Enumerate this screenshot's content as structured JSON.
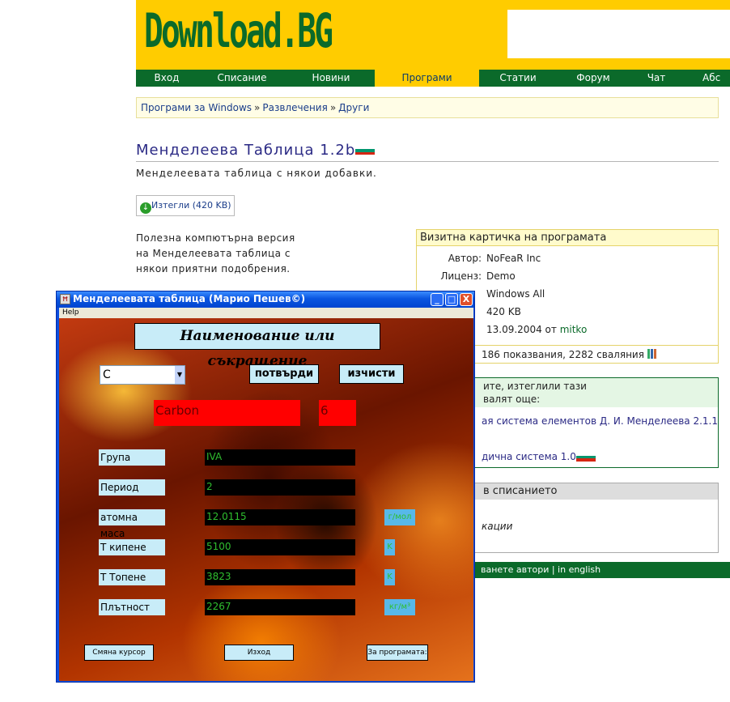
{
  "site": {
    "logo": "Download.BG",
    "nav": [
      "Вход",
      "Списание",
      "Новини",
      "Програми",
      "Статии",
      "Форум",
      "Чат",
      "Абс"
    ],
    "nav_active": "Програми"
  },
  "breadcrumb": [
    "Програми за Windows",
    "Развлечения",
    "Други"
  ],
  "breadcrumb_sep": "»",
  "program": {
    "title": "Менделеева Таблица 1.2b",
    "subtitle": "Менделеевата таблица с някои добавки.",
    "download_label": "Изтегли (420 KB)",
    "description": "Полезна компютърна версия на Менделеевата таблица с някои приятни подобрения."
  },
  "card": {
    "heading": "Визитна картичка на програмата",
    "rows": [
      {
        "label": "Автор:",
        "value": "NoFeaR Inc"
      },
      {
        "label": "Лиценз:",
        "value": "Demo"
      },
      {
        "label": "",
        "value": "Windows All"
      },
      {
        "label": "",
        "value": "420 KB"
      },
      {
        "label": "",
        "value": "13.09.2004 от"
      }
    ],
    "uploader": "mitko",
    "stats": "186 показвания, 2282 сваляния"
  },
  "also": {
    "heading_line1": "ите, изтеглили тази",
    "heading_line2": "валят още:",
    "links": [
      "ая система елементов Д. И. Менделеева 2.1.1",
      "дична система 1.0"
    ]
  },
  "magazine": {
    "heading": "в списанието",
    "link": "кации"
  },
  "footer": "ванете автори | in english",
  "flag_colors": [
    "#ffffff",
    "#00966e",
    "#d62612"
  ],
  "app": {
    "title": "Менделеевата таблица (Марио Пешев©)",
    "menu": "Help",
    "heading": "Наименование или съкращение",
    "combo_value": "C",
    "confirm": "потвърди",
    "clear": "изчисти",
    "element_name": "Carbon",
    "element_number": "6",
    "fields": [
      {
        "label": "Група",
        "value": "IVA",
        "unit": ""
      },
      {
        "label": "Период",
        "value": "2",
        "unit": ""
      },
      {
        "label": "атомна маса",
        "value": "12.0115",
        "unit": "г/мол"
      },
      {
        "label": "Т кипене",
        "value": "5100",
        "unit": "K"
      },
      {
        "label": "Т Топене",
        "value": "3823",
        "unit": "K"
      },
      {
        "label": "Плътност",
        "value": "2267",
        "unit": "кг/м³"
      }
    ],
    "bottom_buttons": [
      "Смяна курсор",
      "Изход",
      "За програмата:"
    ],
    "controls": {
      "minimize": "_",
      "maximize": "□",
      "close": "X"
    }
  }
}
